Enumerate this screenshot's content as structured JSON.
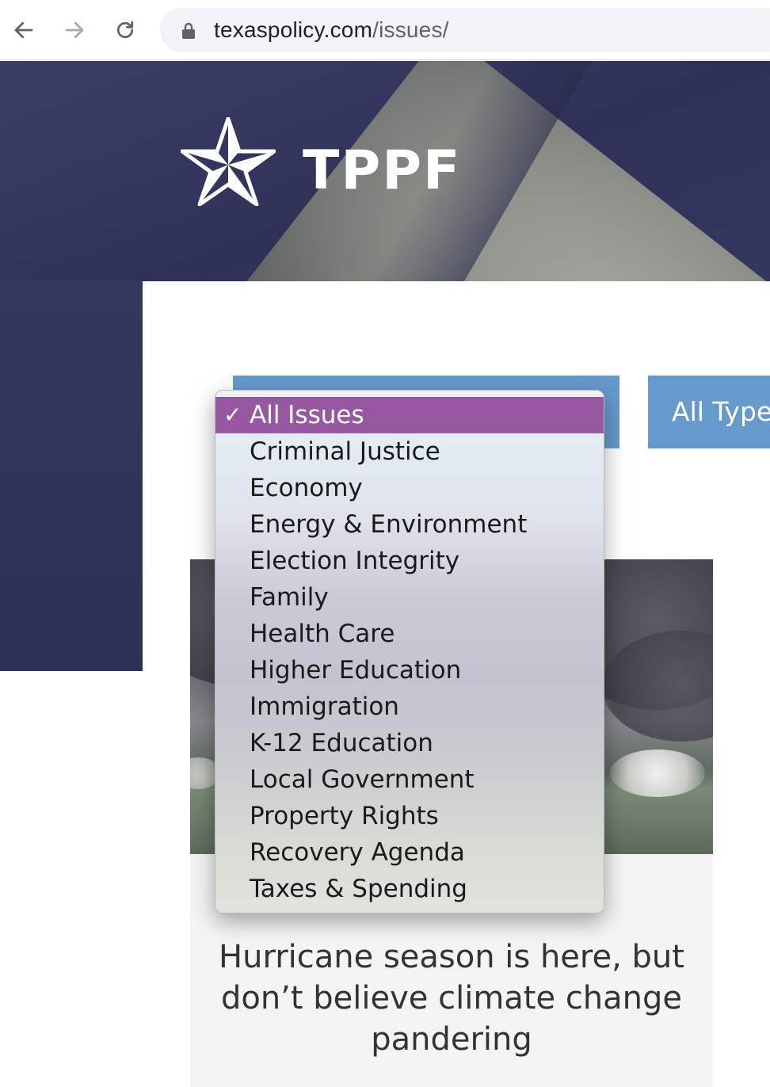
{
  "browser": {
    "back_icon": "arrow-left-icon",
    "forward_icon": "arrow-right-icon",
    "reload_icon": "reload-icon",
    "lock_icon": "lock-icon",
    "url_domain": "texaspolicy.com",
    "url_path": "/issues/"
  },
  "header": {
    "logo_icon": "star-icon",
    "logo_text": "TPPF"
  },
  "filters": {
    "issue_select_value": "All Issues",
    "types_button_label": "All Type"
  },
  "dropdown": {
    "check_glyph": "✓",
    "options": [
      "All Issues",
      "Criminal Justice",
      "Economy",
      "Energy & Environment",
      "Election Integrity",
      "Family",
      "Health Care",
      "Higher Education",
      "Immigration",
      "K-12 Education",
      "Local Government",
      "Property Rights",
      "Recovery Agenda",
      "Taxes & Spending"
    ],
    "selected_index": 0,
    "selected_color": "#9659a1"
  },
  "card": {
    "title": "Hurricane season is here, but don’t believe climate change pandering"
  },
  "colors": {
    "hero": "#2f3258",
    "button_blue": "#6699cc"
  }
}
